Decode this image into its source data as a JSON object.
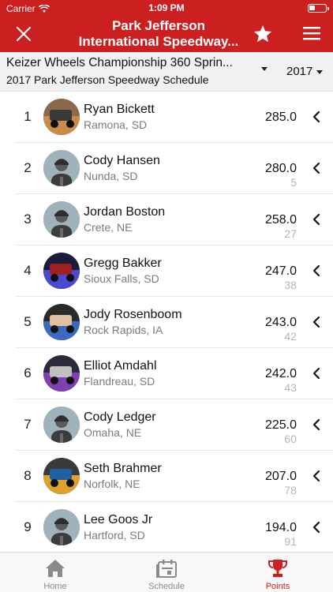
{
  "status": {
    "carrier": "Carrier",
    "time": "1:09 PM"
  },
  "nav": {
    "title_line1": "Park Jefferson",
    "title_line2": "International Speedway..."
  },
  "selector": {
    "series": "Keizer Wheels Championship 360 Sprin...",
    "schedule": "2017 Park Jefferson Speedway Schedule",
    "year": "2017"
  },
  "drivers": [
    {
      "rank": "1",
      "name": "Ryan Bickett",
      "location": "Ramona, SD",
      "points": "285.0",
      "behind": "",
      "avatar": "photo"
    },
    {
      "rank": "2",
      "name": "Cody Hansen",
      "location": "Nunda, SD",
      "points": "280.0",
      "behind": "5",
      "avatar": "placeholder"
    },
    {
      "rank": "3",
      "name": "Jordan Boston",
      "location": "Crete, NE",
      "points": "258.0",
      "behind": "27",
      "avatar": "placeholder"
    },
    {
      "rank": "4",
      "name": "Gregg Bakker",
      "location": "Sioux Falls, SD",
      "points": "247.0",
      "behind": "38",
      "avatar": "photo"
    },
    {
      "rank": "5",
      "name": "Jody Rosenboom",
      "location": "Rock Rapids, IA",
      "points": "243.0",
      "behind": "42",
      "avatar": "photo"
    },
    {
      "rank": "6",
      "name": "Elliot Amdahl",
      "location": "Flandreau, SD",
      "points": "242.0",
      "behind": "43",
      "avatar": "photo"
    },
    {
      "rank": "7",
      "name": "Cody Ledger",
      "location": "Omaha, NE",
      "points": "225.0",
      "behind": "60",
      "avatar": "placeholder"
    },
    {
      "rank": "8",
      "name": "Seth Brahmer",
      "location": "Norfolk, NE",
      "points": "207.0",
      "behind": "78",
      "avatar": "photo"
    },
    {
      "rank": "9",
      "name": "Lee Goos Jr",
      "location": "Hartford, SD",
      "points": "194.0",
      "behind": "91",
      "avatar": "placeholder"
    }
  ],
  "tabs": [
    {
      "label": "Home",
      "icon": "home-icon",
      "active": false
    },
    {
      "label": "Schedule",
      "icon": "calendar-icon",
      "active": false
    },
    {
      "label": "Points",
      "icon": "trophy-icon",
      "active": true
    }
  ],
  "colors": {
    "brand": "#cc1f1f",
    "avatar_bg": "#9fb3bd",
    "muted": "#7b7b7b",
    "behind": "#b5b5b5"
  }
}
